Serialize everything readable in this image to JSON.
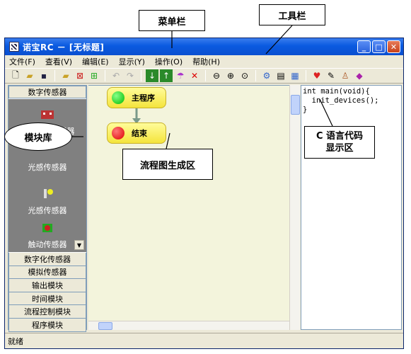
{
  "callouts": {
    "menubar": "菜单栏",
    "toolbar": "工具栏",
    "module_lib": "模块库",
    "flow_area": "流程图生成区",
    "code_area_line1": "C 语言代码",
    "code_area_line2": "显示区"
  },
  "window": {
    "title": "诺宝RC － [无标题]",
    "buttons": {
      "minimize": "_",
      "maximize": "□",
      "close": "✕"
    }
  },
  "menubar": {
    "items": [
      "文件(F)",
      "查看(V)",
      "编辑(E)",
      "显示(Y)",
      "操作(O)",
      "帮助(H)"
    ]
  },
  "toolbar": {
    "icons": [
      "new-file-icon",
      "open-folder-icon",
      "save-icon",
      "folder-icon",
      "delete-file-icon",
      "add-icon",
      "undo-icon",
      "redo-icon",
      "download-icon",
      "upload-icon",
      "convert-icon",
      "delete-icon",
      "zoom-out-icon",
      "zoom-in-icon",
      "zoom-fit-icon",
      "flow-icon",
      "doc-icon",
      "compile-icon",
      "heart-icon",
      "edit-icon",
      "user-icon",
      "book-icon"
    ]
  },
  "module_library": {
    "active_category": "数字传感器",
    "items": [
      "红外避障传感器",
      "光感传感器",
      "光感传感器",
      "触动传感器"
    ],
    "categories": [
      "数字化传感器",
      "模拟传感器",
      "输出模块",
      "时间模块",
      "流程控制模块",
      "程序模块"
    ]
  },
  "flow": {
    "nodes": [
      {
        "label": "主程序",
        "color": "green"
      },
      {
        "label": "结束",
        "color": "red"
      }
    ]
  },
  "code": {
    "lines": [
      "int main(void){",
      "  init_devices();",
      "}"
    ]
  },
  "status": {
    "text": "就绪"
  }
}
